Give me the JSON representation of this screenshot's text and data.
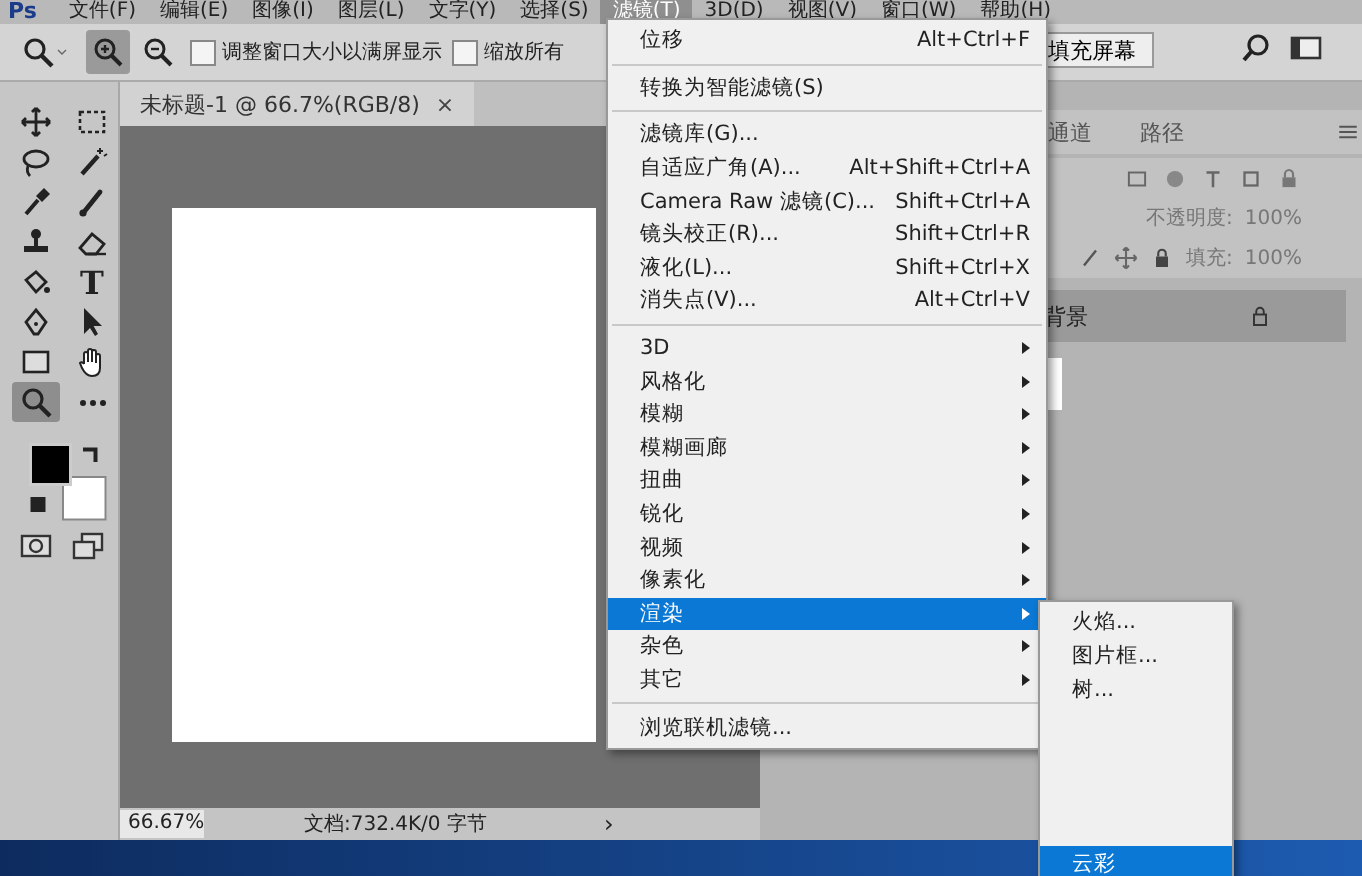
{
  "menu_bar": {
    "logo": "Ps",
    "items": [
      {
        "label": "文件(F)",
        "selected": false
      },
      {
        "label": "编辑(E)",
        "selected": false
      },
      {
        "label": "图像(I)",
        "selected": false
      },
      {
        "label": "图层(L)",
        "selected": false
      },
      {
        "label": "文字(Y)",
        "selected": false
      },
      {
        "label": "选择(S)",
        "selected": false
      },
      {
        "label": "滤镜(T)",
        "selected": true
      },
      {
        "label": "3D(D)",
        "selected": false
      },
      {
        "label": "视图(V)",
        "selected": false
      },
      {
        "label": "窗口(W)",
        "selected": false
      },
      {
        "label": "帮助(H)",
        "selected": false
      }
    ]
  },
  "options_bar": {
    "zoom_in_selected": true,
    "checkboxes": [
      {
        "label": "调整窗口大小以满屏显示",
        "checked": false
      },
      {
        "label": "缩放所有",
        "checked": false
      }
    ],
    "fill_screen_button": "填充屏幕"
  },
  "document_tab": {
    "title": "未标题-1 @ 66.7%(RGB/8)",
    "close": "×"
  },
  "tools": [
    {
      "kind": "move",
      "selected": false
    },
    {
      "kind": "marquee",
      "selected": false
    },
    {
      "kind": "lasso",
      "selected": false
    },
    {
      "kind": "wand",
      "selected": false
    },
    {
      "kind": "eyedropper",
      "selected": false
    },
    {
      "kind": "brush",
      "selected": false
    },
    {
      "kind": "stamp",
      "selected": false
    },
    {
      "kind": "eraser",
      "selected": false
    },
    {
      "kind": "bucket",
      "selected": false
    },
    {
      "kind": "text",
      "selected": false,
      "glyph": "T"
    },
    {
      "kind": "pen",
      "selected": false
    },
    {
      "kind": "pointer",
      "selected": false
    },
    {
      "kind": "rectangle",
      "selected": false
    },
    {
      "kind": "hand",
      "selected": false
    },
    {
      "kind": "zoom",
      "selected": true
    },
    {
      "kind": "more",
      "selected": false
    }
  ],
  "layers_panel": {
    "tabs": [
      {
        "label": "通道",
        "selected": false
      },
      {
        "label": "路径",
        "selected": false
      }
    ],
    "opacity_label": "不透明度:",
    "opacity": "100%",
    "fill_label": "填充:",
    "fill": "100%",
    "layers": [
      {
        "name": "背景",
        "locked": true
      }
    ]
  },
  "status_bar": {
    "zoom": "66.67%",
    "doc_info": "文档:732.4K/0 字节",
    "arrow": "›"
  },
  "filter_menu": {
    "items": [
      {
        "kind": "item",
        "label": "位移",
        "shortcut": "Alt+Ctrl+F",
        "submenu": false,
        "selected": false
      },
      {
        "kind": "separator"
      },
      {
        "kind": "item",
        "label": "转换为智能滤镜(S)",
        "submenu": false,
        "selected": false
      },
      {
        "kind": "separator"
      },
      {
        "kind": "item",
        "label": "滤镜库(G)...",
        "submenu": false,
        "selected": false
      },
      {
        "kind": "item",
        "label": "自适应广角(A)...",
        "shortcut": "Alt+Shift+Ctrl+A",
        "submenu": false,
        "selected": false
      },
      {
        "kind": "item",
        "label": "Camera Raw 滤镜(C)...",
        "shortcut": "Shift+Ctrl+A",
        "submenu": false,
        "selected": false
      },
      {
        "kind": "item",
        "label": "镜头校正(R)...",
        "shortcut": "Shift+Ctrl+R",
        "submenu": false,
        "selected": false
      },
      {
        "kind": "item",
        "label": "液化(L)...",
        "shortcut": "Shift+Ctrl+X",
        "submenu": false,
        "selected": false
      },
      {
        "kind": "item",
        "label": "消失点(V)...",
        "shortcut": "Alt+Ctrl+V",
        "submenu": false,
        "selected": false
      },
      {
        "kind": "separator"
      },
      {
        "kind": "item",
        "label": "3D",
        "submenu": true,
        "selected": false
      },
      {
        "kind": "item",
        "label": "风格化",
        "submenu": true,
        "selected": false
      },
      {
        "kind": "item",
        "label": "模糊",
        "submenu": true,
        "selected": false
      },
      {
        "kind": "item",
        "label": "模糊画廊",
        "submenu": true,
        "selected": false
      },
      {
        "kind": "item",
        "label": "扭曲",
        "submenu": true,
        "selected": false
      },
      {
        "kind": "item",
        "label": "锐化",
        "submenu": true,
        "selected": false
      },
      {
        "kind": "item",
        "label": "视频",
        "submenu": true,
        "selected": false
      },
      {
        "kind": "item",
        "label": "像素化",
        "submenu": true,
        "selected": false
      },
      {
        "kind": "item",
        "label": "渲染",
        "submenu": true,
        "selected": true
      },
      {
        "kind": "item",
        "label": "杂色",
        "submenu": true,
        "selected": false
      },
      {
        "kind": "item",
        "label": "其它",
        "submenu": true,
        "selected": false
      },
      {
        "kind": "separator"
      },
      {
        "kind": "item",
        "label": "浏览联机滤镜...",
        "submenu": false,
        "selected": false
      }
    ]
  },
  "render_submenu": {
    "items": [
      {
        "label": "火焰...",
        "selected": false
      },
      {
        "label": "图片框...",
        "selected": false
      },
      {
        "label": "树...",
        "selected": false
      },
      {
        "label": "云彩",
        "selected": true
      }
    ]
  }
}
